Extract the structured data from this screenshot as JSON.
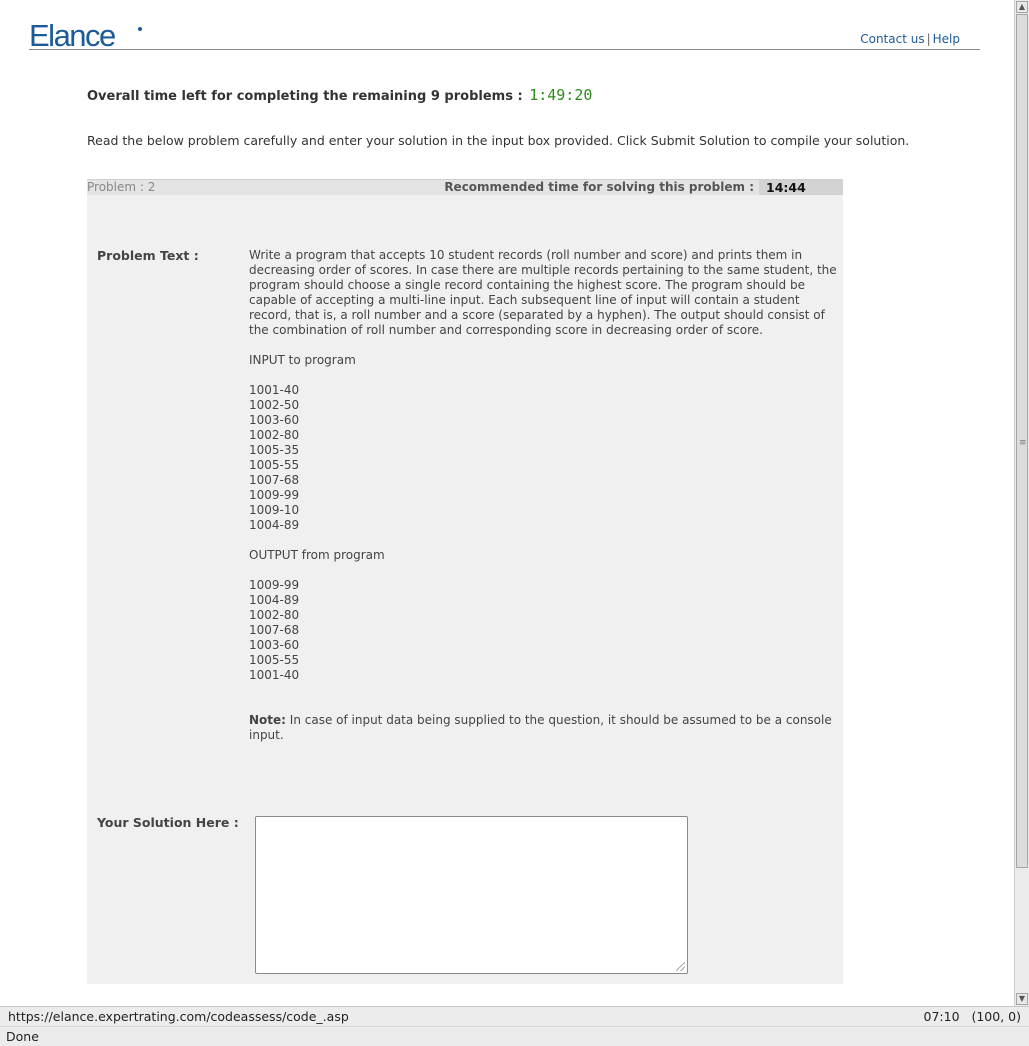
{
  "header": {
    "logo_text": "Elance",
    "links": {
      "contact": "Contact us",
      "separator": "|",
      "help": "Help"
    },
    "brand_color": "#1c5a98"
  },
  "timer": {
    "label": "Overall time left for completing the remaining 9 problems :",
    "value": "1:49:20",
    "color": "#2e8b1d"
  },
  "instruction": "Read the below problem carefully and enter your solution in the input box provided. Click Submit Solution to compile your solution.",
  "problem": {
    "number_label": "Problem : 2",
    "recommended_label": "Recommended time for solving this problem :",
    "recommended_time": "14:44",
    "text_label": "Problem Text :",
    "description": "Write a program that accepts 10 student records (roll number and score) and prints them in decreasing order of scores. In case there are multiple records pertaining to the same student, the program should choose a single record containing the highest score. The program should be capable of accepting a multi-line input. Each subsequent line of input will contain a student record, that is, a roll number and a score (separated by a hyphen). The output should consist of the combination of roll number and corresponding score in decreasing order of score.",
    "input_heading": "INPUT to program",
    "input_lines": [
      "1001-40",
      "1002-50",
      "1003-60",
      "1002-80",
      "1005-35",
      "1005-55",
      "1007-68",
      "1009-99",
      "1009-10",
      "1004-89"
    ],
    "output_heading": "OUTPUT from program",
    "output_lines": [
      "1009-99",
      "1004-89",
      "1002-80",
      "1007-68",
      "1003-60",
      "1005-55",
      "1001-40"
    ],
    "note_label": "Note:",
    "note_text": " In case of input data being supplied to the question, it should be assumed to be a console input."
  },
  "solution": {
    "label": "Your Solution Here :",
    "value": ""
  },
  "browser": {
    "url": "https://elance.expertrating.com/codeassess/code_.asp",
    "right_info": "07:10   (100, 0)",
    "status": "Done"
  }
}
